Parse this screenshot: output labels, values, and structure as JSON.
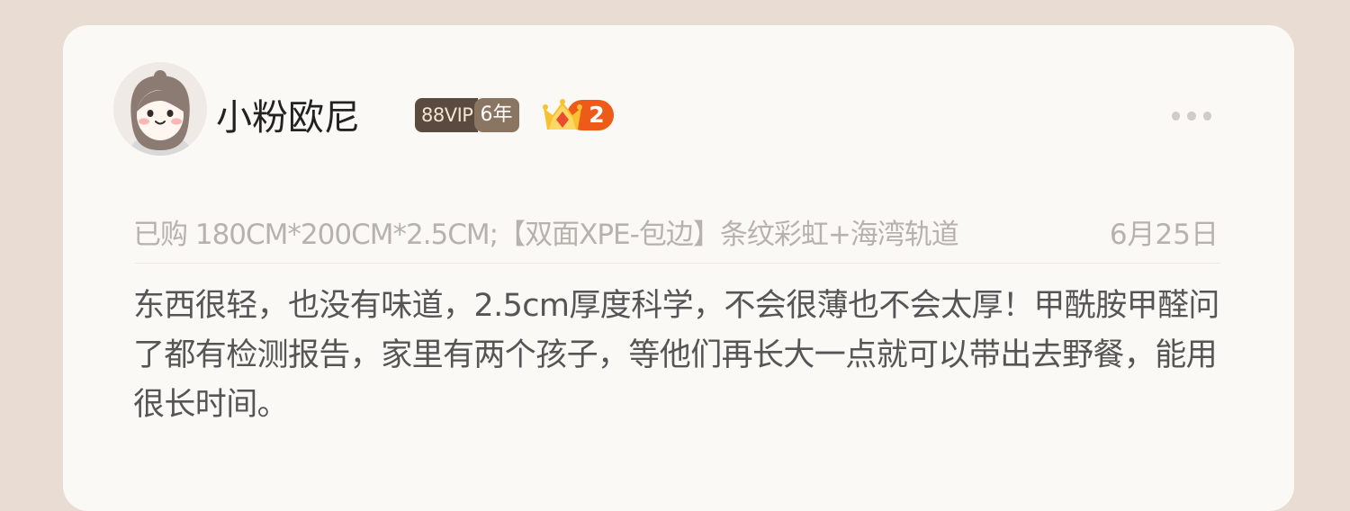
{
  "user": {
    "name": "小粉欧尼",
    "vip_label": "88VIP",
    "vip_years": "6年",
    "level": "2"
  },
  "purchase": {
    "text": "已购 180CM*200CM*2.5CM;【双面XPE-包边】条纹彩虹+海湾轨道",
    "date": "6月25日"
  },
  "review": {
    "text": "东西很轻，也没有味道，2.5cm厚度科学，不会很薄也不会太厚！甲酰胺甲醛问了都有检测报告，家里有两个孩子，等他们再长大一点就可以带出去野餐，能用很长时间。"
  },
  "colors": {
    "background": "#e9ddd3",
    "card": "#fbf9f6",
    "vip": "#5a4a3f",
    "level": "#ee5a18",
    "muted_text": "#b7b2ad",
    "body_text": "#555555"
  },
  "icons": {
    "avatar": "avatar-icon",
    "crown": "crown-icon",
    "more": "more-icon"
  }
}
